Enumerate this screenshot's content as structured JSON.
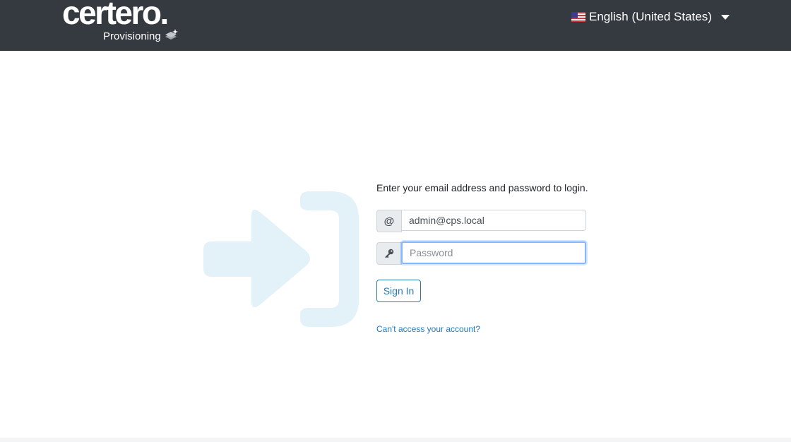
{
  "header": {
    "logo_text": "certero.",
    "sub_label": "Provisioning",
    "language": {
      "label": "English (United States)",
      "flag_icon": "us-flag-icon"
    },
    "background_color": "#343a40"
  },
  "login": {
    "intro_text": "Enter your email address and password to login.",
    "email": {
      "addon_symbol": "@",
      "value": "admin@cps.local"
    },
    "password": {
      "addon_icon": "key-icon",
      "placeholder": "Password",
      "value": ""
    },
    "submit_label": "Sign In",
    "forgot_link": "Can't access your account?"
  },
  "colors": {
    "accent": "#2a7aae",
    "link": "#1f78c1",
    "illustration": "#e3f1f8"
  }
}
